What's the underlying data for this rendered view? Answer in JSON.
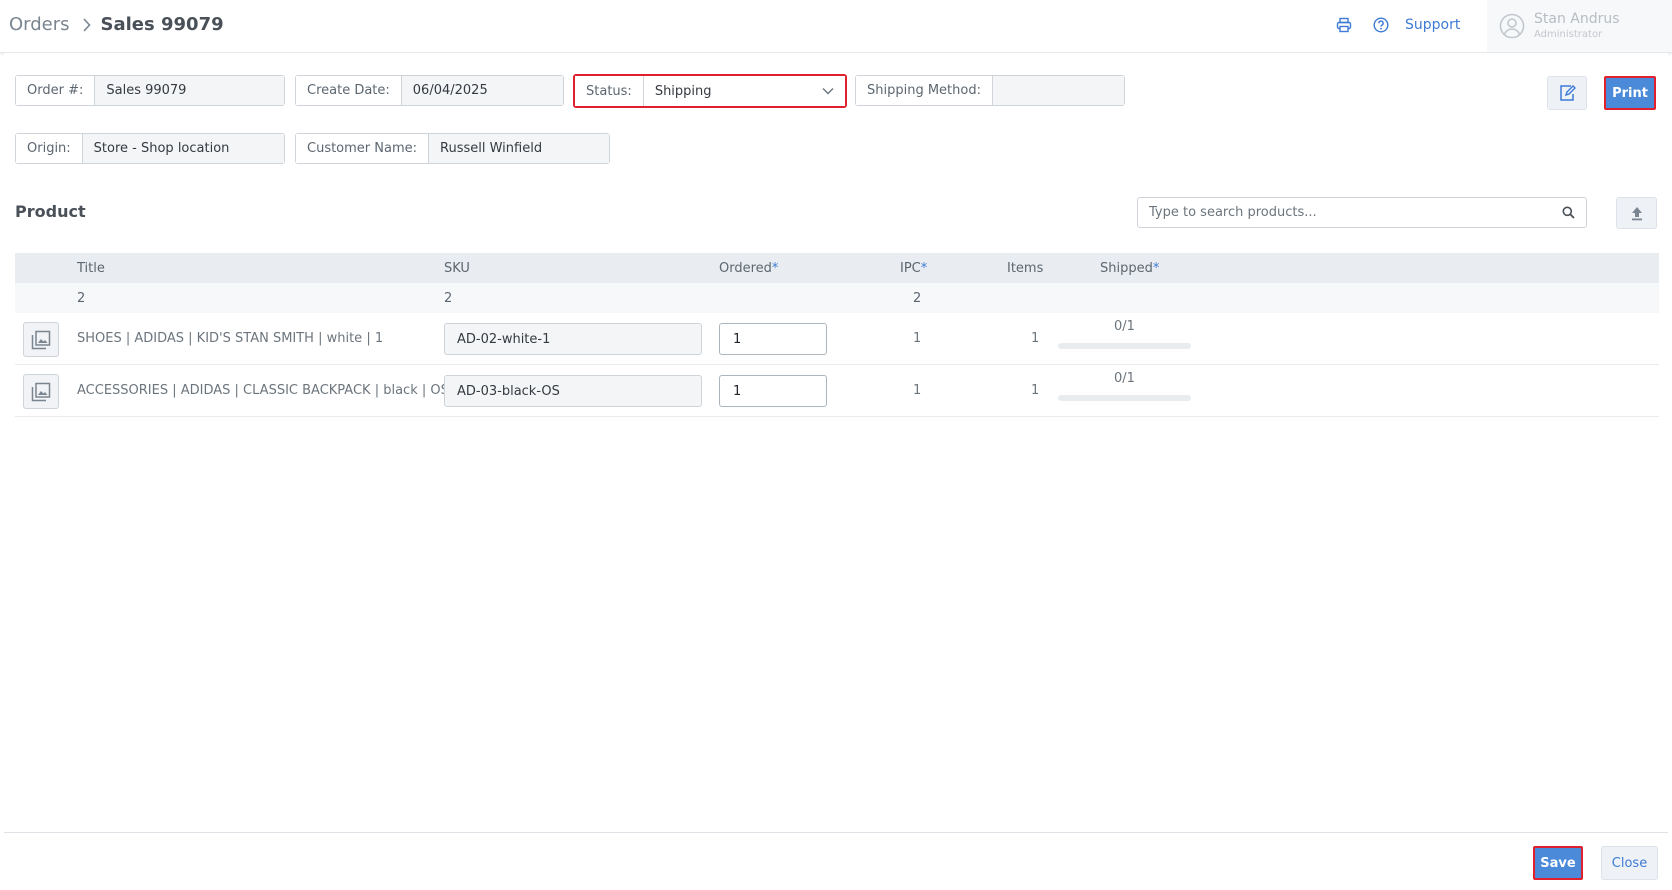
{
  "breadcrumb": {
    "root": "Orders",
    "current": "Sales 99079"
  },
  "header": {
    "support_label": "Support"
  },
  "user": {
    "name": "Stan Andrus",
    "role": "Administrator"
  },
  "order": {
    "order_no_label": "Order #:",
    "order_no": "Sales 99079",
    "create_date_label": "Create Date:",
    "create_date": "06/04/2025",
    "status_label": "Status:",
    "status": "Shipping",
    "shipping_method_label": "Shipping Method:",
    "shipping_method": "",
    "origin_label": "Origin:",
    "origin": "Store - Shop location",
    "customer_label": "Customer Name:",
    "customer": "Russell Winfield"
  },
  "actions": {
    "print_label": "Print",
    "save_label": "Save",
    "close_label": "Close"
  },
  "products": {
    "heading": "Product",
    "search_placeholder": "Type to search products...",
    "columns": {
      "title": "Title",
      "sku": "SKU",
      "ordered": "Ordered",
      "ipc": "IPC",
      "items": "Items",
      "shipped": "Shipped",
      "required_mark": "*"
    },
    "summary": {
      "title": "2",
      "sku": "2",
      "ipc": "2"
    },
    "rows": [
      {
        "title": "SHOES | ADIDAS | KID'S STAN SMITH | white | 1",
        "sku": "AD-02-white-1",
        "ordered": "1",
        "ipc": "1",
        "items": "1",
        "shipped": "0/1",
        "shipped_fraction": 0
      },
      {
        "title": "ACCESSORIES | ADIDAS | CLASSIC BACKPACK | black | OS",
        "sku": "AD-03-black-OS",
        "ordered": "1",
        "ipc": "1",
        "items": "1",
        "shipped": "0/1",
        "shipped_fraction": 0
      }
    ]
  },
  "colors": {
    "accent": "#4a8ad9",
    "highlight_border": "#e0202c"
  }
}
